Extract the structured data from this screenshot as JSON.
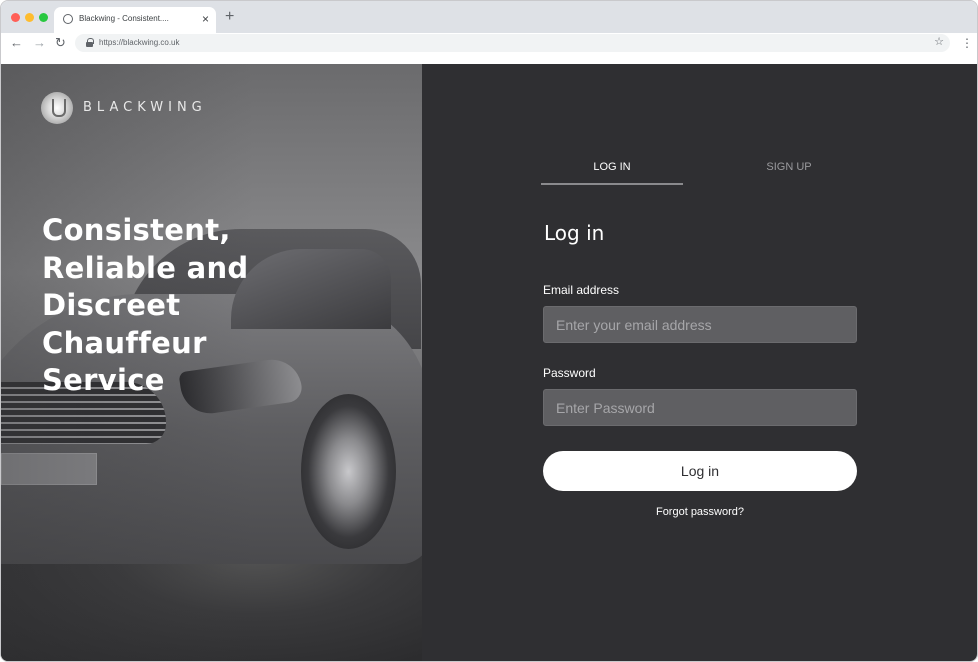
{
  "browser": {
    "tab_title": "Blackwing - Consistent....",
    "tab_close": "×",
    "new_tab": "+",
    "url": "https://blackwing.co.uk",
    "back": "←",
    "forward": "→",
    "reload": "↻",
    "bookmark_star": "☆",
    "menu": "⋮"
  },
  "hero": {
    "brand_name": "BLACKWING",
    "tagline": "Consistent, Reliable and Discreet Chauffeur Service"
  },
  "auth": {
    "tabs": [
      {
        "label": "LOG IN",
        "active": true
      },
      {
        "label": "SIGN UP",
        "active": false
      }
    ],
    "title": "Log in",
    "email_label": "Email address",
    "email_placeholder": "Enter your email address",
    "password_label": "Password",
    "password_placeholder": "Enter Password",
    "submit_label": "Log in",
    "forgot_label": "Forgot password?"
  },
  "colors": {
    "panel_bg": "#2f2f32",
    "field_bg": "#5f5f62",
    "button_bg": "#ffffff"
  },
  "icons": {
    "favicon": "globe-icon",
    "lock": "lock-icon",
    "star": "star-icon",
    "menu": "kebab-menu-icon"
  }
}
